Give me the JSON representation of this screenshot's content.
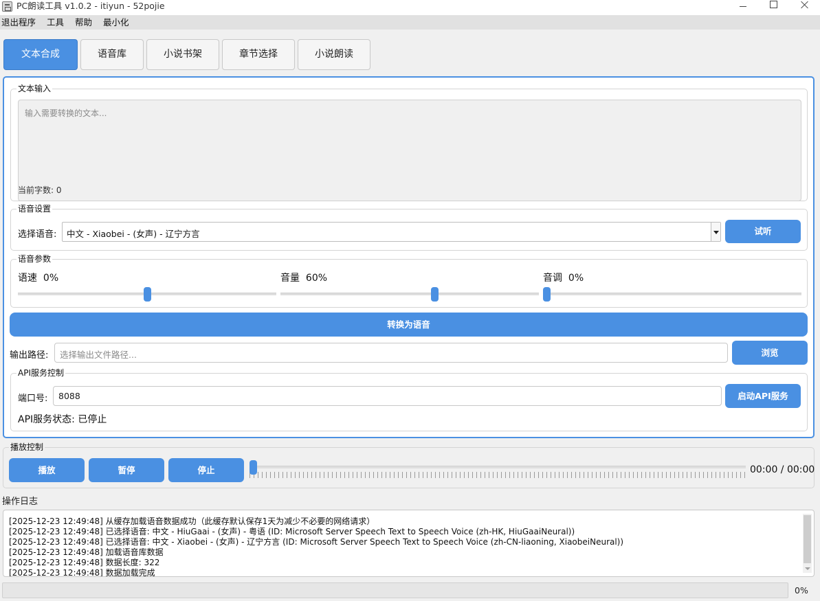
{
  "window": {
    "title": "PC朗读工具 v1.0.2 - itiyun - 52pojie",
    "icon": "app-icon"
  },
  "menu": [
    "退出程序",
    "工具",
    "帮助",
    "最小化"
  ],
  "tabs": [
    {
      "label": "文本合成",
      "active": true
    },
    {
      "label": "语音库",
      "active": false
    },
    {
      "label": "小说书架",
      "active": false
    },
    {
      "label": "章节选择",
      "active": false
    },
    {
      "label": "小说朗读",
      "active": false
    }
  ],
  "text_input": {
    "group_title": "文本输入",
    "placeholder": "输入需要转换的文本...",
    "char_count": "当前字数: 0"
  },
  "voice_settings": {
    "group_title": "语音设置",
    "select_label": "选择语音:",
    "selected_voice": "中文 - Xiaobei - (女声) - 辽宁方言",
    "preview_button": "试听"
  },
  "voice_params": {
    "group_title": "语音参数",
    "rate": {
      "label": "语速",
      "value": "0%",
      "level": 0.5
    },
    "volume": {
      "label": "音量",
      "value": "60%",
      "level": 0.6
    },
    "pitch": {
      "label": "音调",
      "value": "0%",
      "level": 0.0
    }
  },
  "convert_button": "转换为语音",
  "output": {
    "label": "输出路径:",
    "placeholder": "选择输出文件路径...",
    "browse_button": "浏览"
  },
  "api": {
    "group_title": "API服务控制",
    "port_label": "端口号:",
    "port_value": "8088",
    "start_button": "启动API服务",
    "status": "API服务状态: 已停止"
  },
  "playback": {
    "group_title": "播放控制",
    "play_button": "播放",
    "pause_button": "暂停",
    "stop_button": "停止",
    "time": "00:00 / 00:00",
    "position": 0
  },
  "log": {
    "title": "操作日志",
    "lines": [
      "[2025-12-23 12:49:48] 从缓存加载语音数据成功（此缓存默认保存1天为减少不必要的网络请求）",
      "[2025-12-23 12:49:48] 已选择语音: 中文 - HiuGaai - (女声) - 粤语 (ID: Microsoft Server Speech Text to Speech Voice (zh-HK, HiuGaaiNeural))",
      "[2025-12-23 12:49:48] 已选择语音: 中文 - Xiaobei - (女声) - 辽宁方言 (ID: Microsoft Server Speech Text to Speech Voice (zh-CN-liaoning, XiaobeiNeural))",
      "[2025-12-23 12:49:48] 加载语音库数据",
      "[2025-12-23 12:49:48] 数据长度: 322",
      "[2025-12-23 12:49:48] 数据加载完成"
    ]
  },
  "progress": {
    "value": 0,
    "label": "0%"
  },
  "colors": {
    "accent": "#4a90e2"
  }
}
